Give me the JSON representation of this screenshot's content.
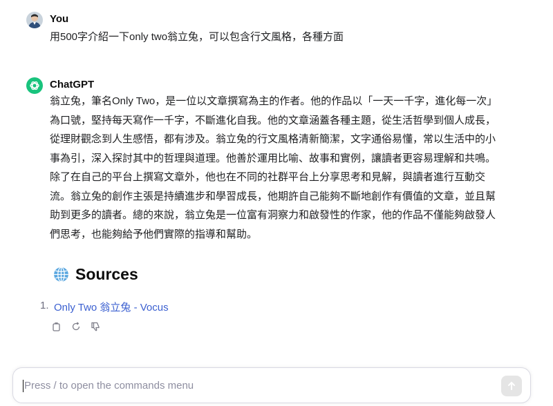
{
  "user": {
    "name": "You",
    "message": "用500字介紹一下only two翁立兔，可以包含行文風格，各種方面"
  },
  "assistant": {
    "name": "ChatGPT",
    "lines": [
      "翁立兔，筆名Only Two，是一位以文章撰寫為主的作者。他的作品以「一天一千字，進化每一次」",
      "為口號，堅持每天寫作一千字，不斷進化自我。他的文章涵蓋各種主題，從生活哲學到個人成長，",
      "從理財觀念到人生感悟，都有涉及。翁立兔的行文風格清新簡潔，文字通俗易懂，常以生活中的小",
      "事為引，深入探討其中的哲理與道理。他善於運用比喻、故事和實例，讓讀者更容易理解和共鳴。",
      "除了在自己的平台上撰寫文章外，他也在不同的社群平台上分享思考和見解，與讀者進行互動交",
      "流。翁立兔的創作主張是持續進步和學習成長，他期許自己能夠不斷地創作有價值的文章，並且幫",
      "助到更多的讀者。總的來說，翁立兔是一位富有洞察力和啟發性的作家，他的作品不僅能夠啟發人",
      "們思考，也能夠給予他們實際的指導和幫助。"
    ]
  },
  "sources": {
    "heading": "Sources",
    "items": [
      {
        "number": "1.",
        "label": "Only Two 翁立兔 - Vocus"
      }
    ]
  },
  "actions": {
    "icons": [
      "copy-icon",
      "regenerate-icon",
      "thumbs-down-icon"
    ]
  },
  "composer": {
    "placeholder": "Press / to open the commands menu"
  },
  "colors": {
    "accent": "#19c37d",
    "link": "#3a5fd0",
    "text": "#202123"
  }
}
